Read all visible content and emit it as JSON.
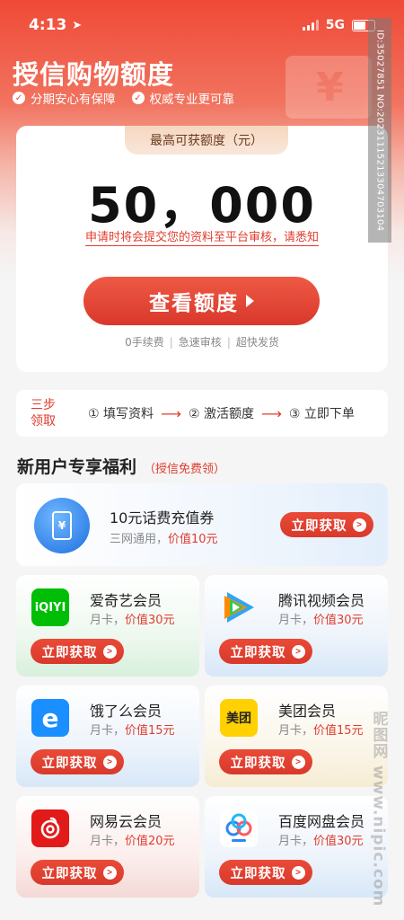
{
  "status": {
    "time": "4:13",
    "network": "5G"
  },
  "header": {
    "title": "授信购物额度",
    "features": [
      "分期安心有保障",
      "权威专业更可靠"
    ]
  },
  "quota": {
    "tag": "最高可获额度（元）",
    "amount": "50，000",
    "notice": "申请时将会提交您的资料至平台审核，请悉知",
    "button": "查看额度",
    "perks": [
      "0手续费",
      "急速审核",
      "超快发货"
    ]
  },
  "steps": {
    "label": "三步领取",
    "items": [
      "① 填写资料",
      "② 激活额度",
      "③ 立即下单"
    ]
  },
  "section": {
    "title": "新用户专享福利",
    "subtitle": "（授信免费领）"
  },
  "coupon": {
    "title": "10元话费充值券",
    "desc_prefix": "三网通用，",
    "desc_value": "价值10元",
    "button": "立即获取"
  },
  "members": [
    {
      "name": "爱奇艺会员",
      "desc_prefix": "月卡，",
      "desc_value": "价值30元",
      "button": "立即获取",
      "logo_text": "iQIYI",
      "icon": "iqiyi-icon"
    },
    {
      "name": "腾讯视频会员",
      "desc_prefix": "月卡，",
      "desc_value": "价值30元",
      "button": "立即获取",
      "logo_text": "",
      "icon": "tencent-video-icon"
    },
    {
      "name": "饿了么会员",
      "desc_prefix": "月卡，",
      "desc_value": "价值15元",
      "button": "立即获取",
      "logo_text": "e",
      "icon": "eleme-icon"
    },
    {
      "name": "美团会员",
      "desc_prefix": "月卡，",
      "desc_value": "价值15元",
      "button": "立即获取",
      "logo_text": "美团",
      "icon": "meituan-icon"
    },
    {
      "name": "网易云会员",
      "desc_prefix": "月卡，",
      "desc_value": "价值20元",
      "button": "立即获取",
      "logo_text": "",
      "icon": "netease-music-icon"
    },
    {
      "name": "百度网盘会员",
      "desc_prefix": "月卡，",
      "desc_value": "价值30元",
      "button": "立即获取",
      "logo_text": "",
      "icon": "baidu-netdisk-icon"
    }
  ],
  "watermarks": {
    "id": "ID:35027851 NO:20231115213304703104",
    "site": "昵图网 www.nipic.com"
  },
  "colors": {
    "accent": "#e03c2e",
    "hero": "#ef4a36"
  }
}
